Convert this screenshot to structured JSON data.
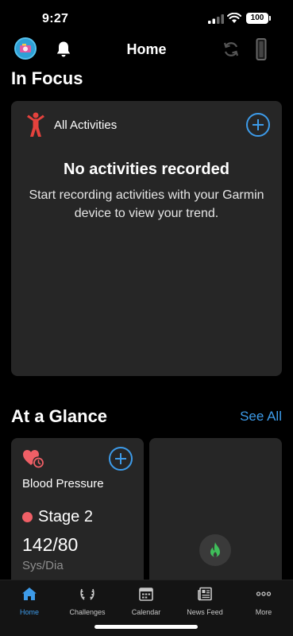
{
  "status_bar": {
    "time": "9:27",
    "battery": "100"
  },
  "header": {
    "title": "Home"
  },
  "in_focus": {
    "section_title": "In Focus",
    "activity_label": "All Activities",
    "empty_title": "No activities recorded",
    "empty_text": "Start recording activities with your Garmin device to view your trend."
  },
  "at_a_glance": {
    "section_title": "At a Glance",
    "see_all": "See All",
    "blood_pressure": {
      "label": "Blood Pressure",
      "stage": "Stage 2",
      "value": "142/80",
      "unit": "Sys/Dia"
    }
  },
  "tabs": [
    {
      "label": "Home",
      "icon": "home-icon",
      "active": true
    },
    {
      "label": "Challenges",
      "icon": "laurel-icon",
      "active": false
    },
    {
      "label": "Calendar",
      "icon": "calendar-icon",
      "active": false
    },
    {
      "label": "News Feed",
      "icon": "newsfeed-icon",
      "active": false
    },
    {
      "label": "More",
      "icon": "more-icon",
      "active": false
    }
  ],
  "colors": {
    "accent": "#3d9be9",
    "stage": "#ef5f66",
    "activity": "#e5423d",
    "flame": "#3fbf5a"
  }
}
